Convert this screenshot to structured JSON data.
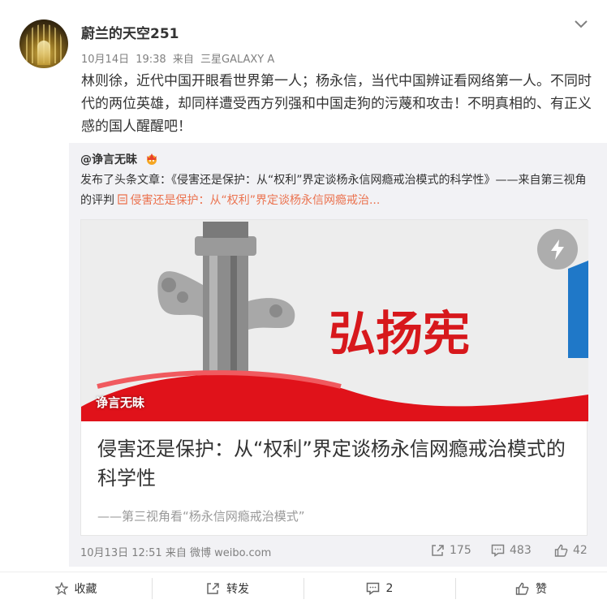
{
  "post": {
    "username": "蔚兰的天空251",
    "date": "10月14日",
    "time": "19:38",
    "via_label": "来自",
    "device": "三星GALAXY A",
    "text": "林则徐，近代中国开眼看世界第一人；杨永信，当代中国辨证看网络第一人。不同时代的两位英雄，却同样遭受西方列强和中国走狗的污蔑和攻击！不明真相的、有正义感的国人醒醒吧！"
  },
  "repost": {
    "username": "@诤言无昧",
    "text": "发布了头条文章：《侵害还是保护：从“权利”界定谈杨永信网瘾戒治模式的科学性》——来自第三视角的评判",
    "link_text": "侵害还是保护：从“权利”界定谈杨永信网瘾戒治...",
    "card": {
      "image_text": "弘扬宪",
      "watermark": "诤言无昧",
      "title": "侵害还是保护：从“权利”界定谈杨永信网瘾戒治模式的科学性",
      "subtitle": "——第三视角看“杨永信网瘾戒治模式”"
    },
    "footer": {
      "date": "10月13日",
      "time": "12:51",
      "via_label": "来自",
      "source": "微博 weibo.com",
      "reposts": "175",
      "comments": "483",
      "likes": "42"
    }
  },
  "actions": {
    "favorite": "收藏",
    "repost": "转发",
    "comments": "2",
    "like": "赞"
  },
  "icons": {
    "menu": "chevron-down-icon",
    "crown": "crown-icon",
    "link": "article-link-icon",
    "flash": "lightning-icon",
    "repost": "repost-icon",
    "comment": "comment-icon",
    "like": "thumbs-up-icon",
    "favorite": "star-icon"
  },
  "colors": {
    "link": "#eb7350",
    "repost_bg": "#f2f2f5",
    "text": "#333333",
    "meta": "#808080",
    "banner_red": "#d7181c"
  }
}
